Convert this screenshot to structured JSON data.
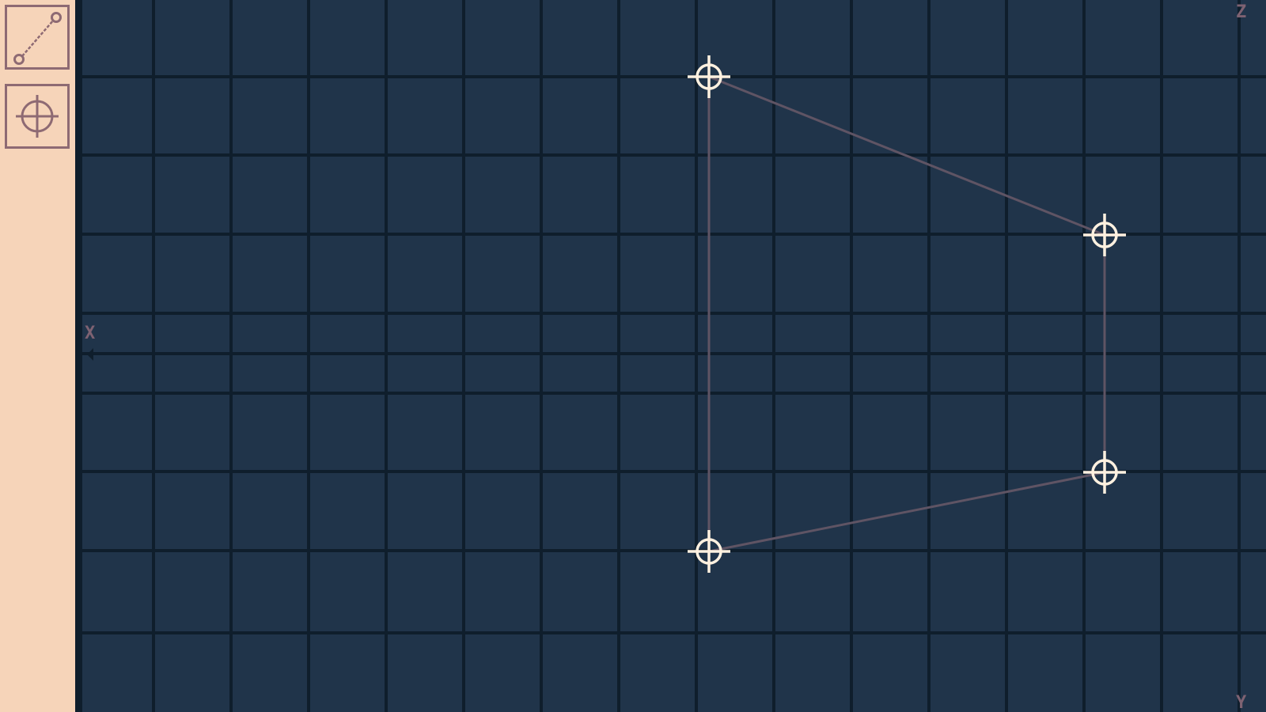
{
  "toolbar": {
    "tools": [
      {
        "id": "line",
        "icon": "line-tool-icon",
        "selected": false
      },
      {
        "id": "point",
        "icon": "crosshair-point-icon",
        "selected": false
      }
    ]
  },
  "canvas": {
    "axis_labels": {
      "top_right": "Z",
      "left": "X",
      "bottom_right": "Y"
    },
    "vertex_icon": "crosshair-icon"
  },
  "colors": {
    "sidebar_bg": "#f6d4b9",
    "sidebar_border": "#0f1e2c",
    "canvas_bg": "#20344a",
    "grid_line": "#0f1e2c",
    "tool_outline": "#8e6a73",
    "edge_line": "#5f5464",
    "vertex_white": "#fff1e0",
    "axis_label": "#7e6272"
  }
}
